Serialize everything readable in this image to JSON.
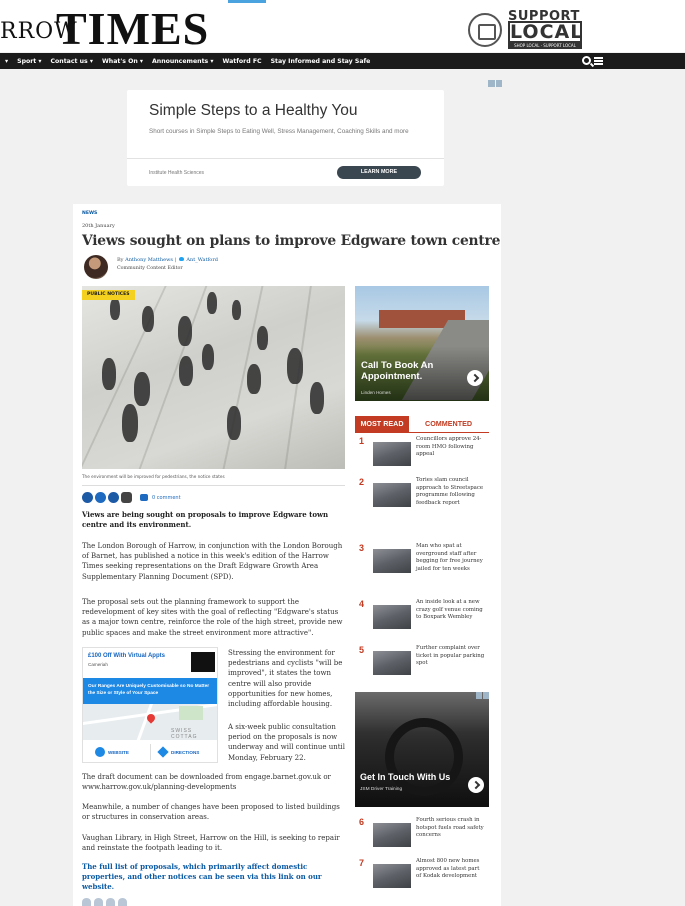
{
  "masthead": {
    "prefix": "RROW",
    "title": "TIMES",
    "support_line1": "SUPPORT",
    "support_line2": "LOCAL",
    "support_line3": "SHOP LOCAL · SUPPORT LOCAL"
  },
  "nav": {
    "items": [
      "▾",
      "Sport ▾",
      "Contact us ▾",
      "What's On ▾",
      "Announcements ▾",
      "Watford FC",
      "Stay Informed and Stay Safe"
    ]
  },
  "top_ad": {
    "title": "Simple Steps to a Healthy You",
    "description": "Short courses in Simple Steps to Eating Well, Stress Management, Coaching Skills and more",
    "source": "Institute Health Sciences",
    "cta": "LEARN MORE"
  },
  "article": {
    "kicker": "NEWS",
    "date": "20th January",
    "headline": "Views sought on plans to improve Edgware town centre",
    "byline_prefix": "By",
    "author": "Anthony Matthews",
    "twitter": "Ant_Watford",
    "author_role": "Community Content Editor",
    "image_badge": "PUBLIC NOTICES",
    "caption": "The environment will be improved for pedestrians, the notice states",
    "comments": "0 comment",
    "standfirst": "Views are being sought on proposals to improve Edgware town centre and its environment.",
    "para1": "The London Borough of Harrow, in conjunction with the London Borough of Barnet, has published a notice in this week's edition of the Harrow Times seeking representations on the Draft Edgware Growth Area Supplementary Planning Document (SPD).",
    "para2": "The proposal sets out the planning framework to support the redevelopment of key sites with the goal of reflecting \"Edgware's status as a major town centre, reinforce the role of the high street, provide new public spaces and make the street environment more attractive\".",
    "para3": "Stressing the environment for pedestrians and cyclists \"will be improved\", it states the town centre will also provide opportunities for new homes, including affordable housing.",
    "para4": "A six-week public consultation period on the proposals is now underway and will continue until Monday, February 22.",
    "para5": "The draft document can be downloaded from engage.barnet.gov.uk or www.harrow.gov.uk/planning-developments",
    "para6": "Meanwhile, a number of changes have been proposed to listed buildings or structures in conservation areas.",
    "para7": "Vaughan Library, in High Street, Harrow on the Hill, is seeking to repair and reinstate the footpath leading to it.",
    "link_para": "The full list of proposals, which primarily affect domestic properties, and other notices can be seen via this link on our website."
  },
  "map_ad": {
    "title": "£100 Off With Virtual Appts",
    "subtitle": "Cameriah",
    "blue_text": "Our Ranges Are Uniquely Customisable so No Matter the Size or Style of Your Space",
    "map_label": "SWISS COTTAG",
    "website": "WEBSITE",
    "directions": "DIRECTIONS"
  },
  "side_ad1": {
    "title": "Call To Book An Appointment.",
    "source": "Linden Homes"
  },
  "most_read": {
    "tab_active": "MOST READ",
    "tab_inactive": "COMMENTED",
    "items": [
      {
        "num": "1",
        "text": "Councillors approve 24-room HMO following appeal"
      },
      {
        "num": "2",
        "text": "Tories slam council approach to Streetspace programme following feedback report"
      },
      {
        "num": "3",
        "text": "Man who spat at overground staff after begging for free journey jailed for ten weeks"
      },
      {
        "num": "4",
        "text": "An inside look at a new crazy golf venue coming to Boxpark Wembley"
      },
      {
        "num": "5",
        "text": "Further complaint over ticket in popular parking spot"
      },
      {
        "num": "6",
        "text": "Fourth serious crash in hotspot fuels road safety concerns"
      },
      {
        "num": "7",
        "text": "Almost 800 new homes approved as latest part of Kodak development"
      }
    ]
  },
  "side_ad2": {
    "title": "Get In Touch With Us",
    "source": "JSM Driver Training"
  }
}
